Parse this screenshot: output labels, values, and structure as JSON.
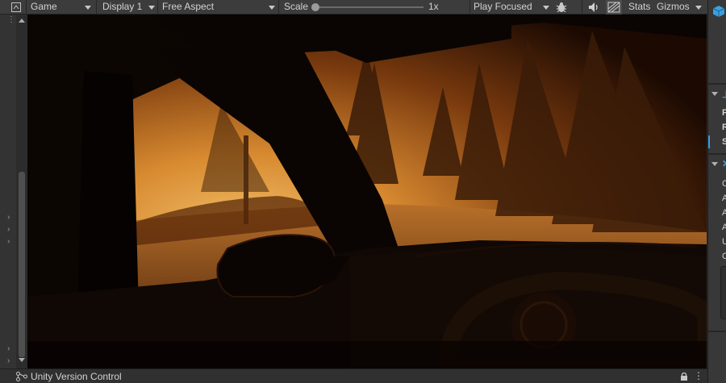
{
  "toolbar": {
    "view_mode": "Game",
    "display": "Display 1",
    "aspect": "Free Aspect",
    "scale_label": "Scale",
    "scale_value": "1x",
    "scale_fraction": 0.0,
    "play_mode": "Play Focused",
    "stats_label": "Stats",
    "gizmos_label": "Gizmos"
  },
  "right_panel": {
    "rows": [
      "P",
      "R",
      "S",
      "C",
      "A",
      "A",
      "A",
      "U",
      "C"
    ]
  },
  "status_bar": {
    "label": "Unity Version Control"
  },
  "colors": {
    "accent_blue": "#3aa0e0",
    "toolbar_bg": "#3c3c3c",
    "sky_glow": "#e0a050"
  },
  "icons": [
    "game-view-icon",
    "dropdown-arrow-icon",
    "bug-icon",
    "audio-mute-icon",
    "stats-toggle-icon",
    "branch-icon",
    "lock-icon",
    "kebab-menu-icon",
    "cube-icon"
  ]
}
